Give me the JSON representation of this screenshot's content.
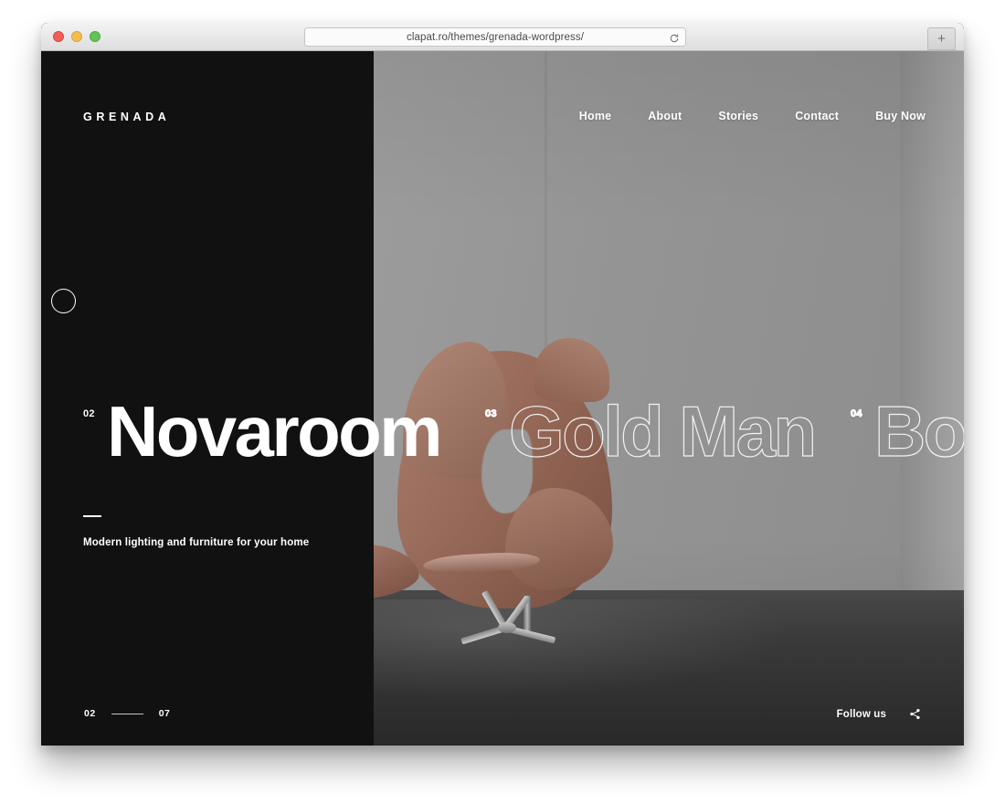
{
  "browser": {
    "url": "clapat.ro/themes/grenada-wordpress/",
    "reload_icon": "reload-icon",
    "new_tab_label": "+",
    "traffic_lights": [
      "close",
      "minimize",
      "maximize"
    ],
    "colors": {
      "close": "#ef5f56",
      "minimize": "#f5bd4f",
      "maximize": "#61c454",
      "chrome_bg": "#e9e9e9"
    }
  },
  "site": {
    "logo": "GRENADA",
    "nav": [
      {
        "label": "Home",
        "active": true
      },
      {
        "label": "About",
        "active": false
      },
      {
        "label": "Stories",
        "active": false
      },
      {
        "label": "Contact",
        "active": false
      },
      {
        "label": "Buy Now",
        "active": false
      }
    ],
    "hero": {
      "slides": [
        {
          "index": "02",
          "title": "Novaroom",
          "state": "active"
        },
        {
          "index": "03",
          "title": "Gold Man",
          "state": "outline"
        },
        {
          "index": "04",
          "title": "Born",
          "state": "outline"
        }
      ],
      "subtitle": "Modern lighting and furniture for your home",
      "dash": "—"
    },
    "slider_counter": {
      "current": "02",
      "total": "07"
    },
    "footer": {
      "follow_label": "Follow us",
      "share_icon": "share-icon"
    },
    "colors": {
      "panel_bg": "#111111",
      "text": "#ffffff",
      "outline_stroke": "rgba(255,255,255,0.88)"
    }
  }
}
